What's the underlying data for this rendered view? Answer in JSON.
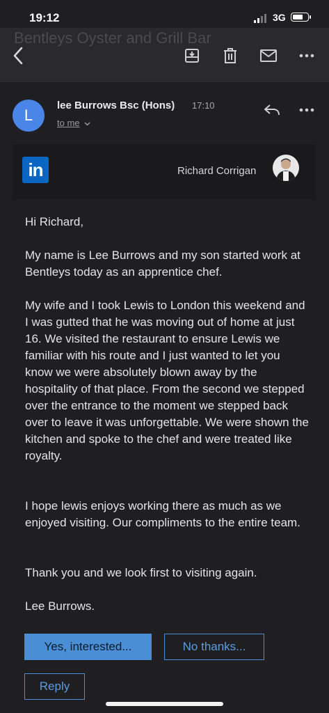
{
  "status_bar": {
    "time": "19:12",
    "network": "3G"
  },
  "toolbar": {
    "ghost_subject": "Bentleys Oyster and Grill Bar",
    "icons": [
      "back-icon",
      "archive-icon",
      "trash-icon",
      "mail-icon",
      "more-icon"
    ]
  },
  "message": {
    "avatar_letter": "L",
    "sender": "lee Burrows Bsc (Hons)",
    "time": "17:10",
    "recipient": "to me"
  },
  "card": {
    "logo_text": "in",
    "name": "Richard Corrigan"
  },
  "body": {
    "greeting": "Hi Richard,",
    "para1": "My name is Lee Burrows and my son started work at Bentleys today as an apprentice chef.",
    "para2": "My wife and I took Lewis to London this weekend and I was gutted that he was moving out of home at just 16. We visited the restaurant to ensure Lewis we familiar with his route and I just wanted to let you know we were absolutely blown away by the hospitality of that place. From the second we stepped over the entrance to the moment we stepped back over to leave it was unforgettable. We were shown the kitchen and spoke to the chef and were treated like royalty.",
    "para3": "I hope lewis enjoys working there as much as we enjoyed visiting. Our compliments to the entire team.",
    "para4": "Thank you and we look first to visiting again.",
    "signoff": "Lee Burrows."
  },
  "actions": {
    "yes_label": "Yes, interested...",
    "no_label": "No thanks...",
    "reply_label": "Reply"
  },
  "colors": {
    "accent": "#4a8fd6",
    "avatar": "#4a86e8",
    "linkedin": "#0a66c2"
  }
}
